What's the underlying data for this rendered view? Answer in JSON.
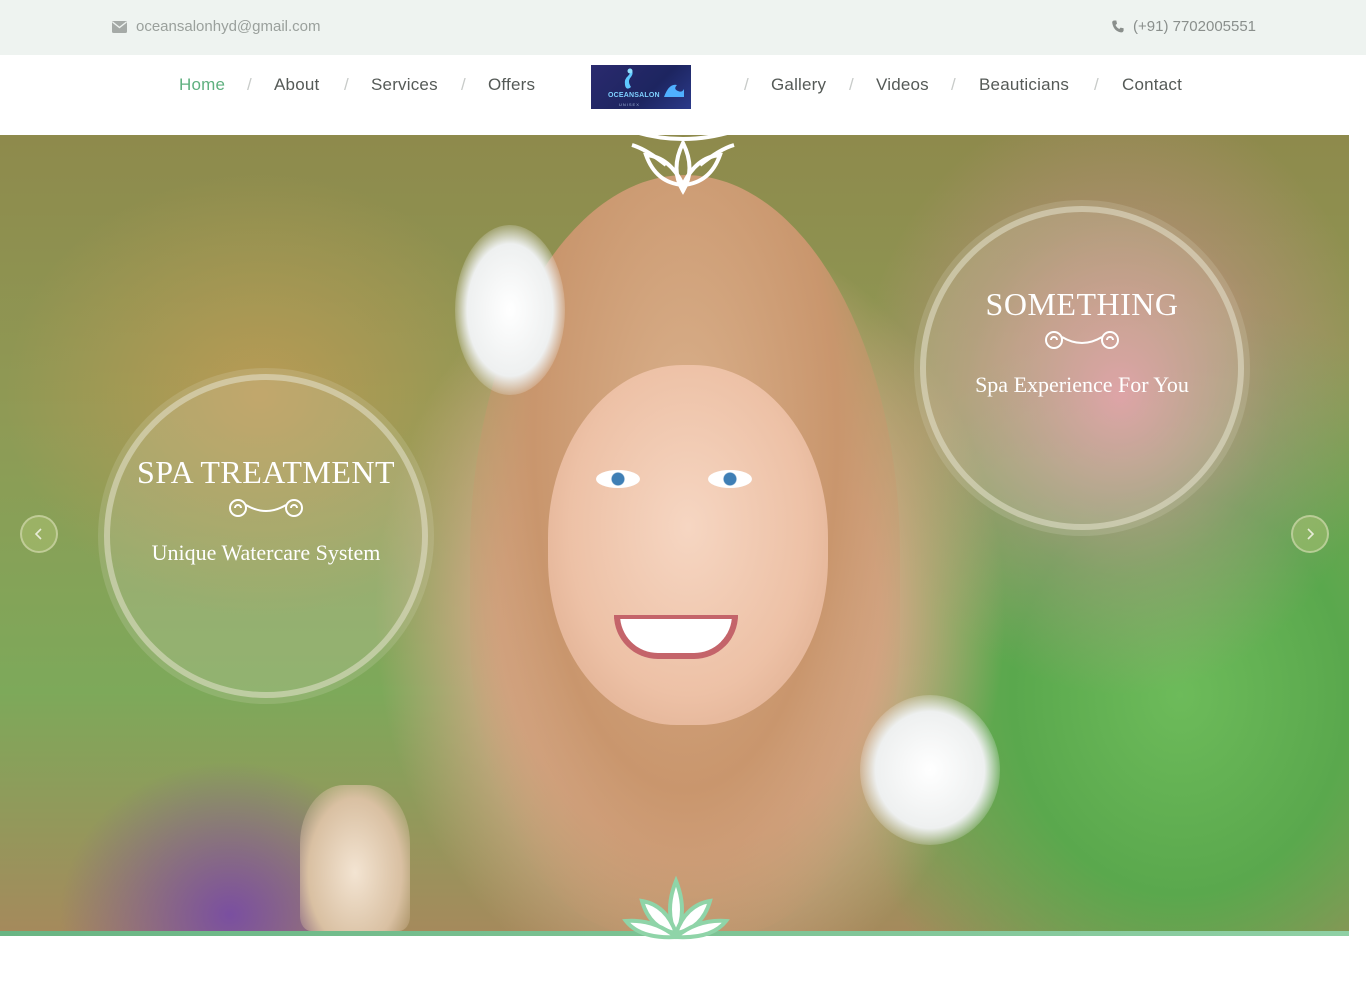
{
  "topbar": {
    "email": "oceansalonhyd@gmail.com",
    "email_icon": "envelope-icon",
    "phone": "(+91) 7702005551",
    "phone_icon": "phone-icon"
  },
  "nav": {
    "left": [
      "Home",
      "About",
      "Services",
      "Offers"
    ],
    "right": [
      "Gallery",
      "Videos",
      "Beauticians",
      "Contact"
    ],
    "separator": "/",
    "active": "Home",
    "active_color": "#5fb07f"
  },
  "logo": {
    "text": "OCEANSALON",
    "subtext": "UNISEX"
  },
  "hero": {
    "left_circle": {
      "title": "SPA TREATMENT",
      "subtitle": "Unique Watercare System"
    },
    "right_circle": {
      "title": "SOMETHING",
      "subtitle": "Spa Experience For You"
    },
    "prev_icon": "chevron-left-icon",
    "next_icon": "chevron-right-icon"
  },
  "colors": {
    "accent_green": "#5fb07f",
    "topbar_bg": "#eef3f0",
    "lotus_green": "#8fd4a8"
  }
}
